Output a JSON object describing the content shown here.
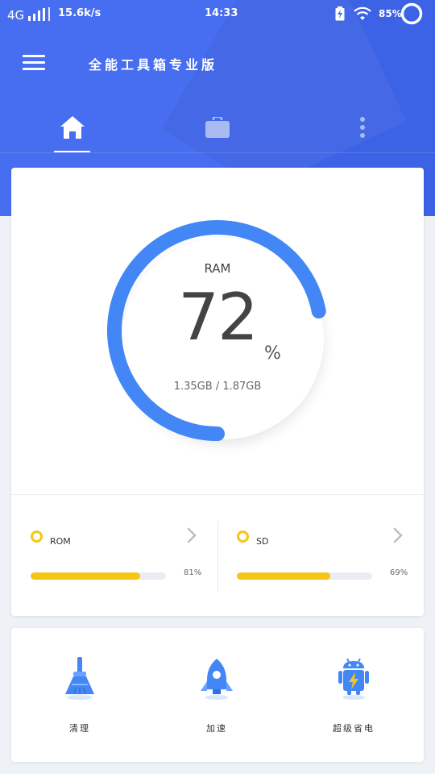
{
  "status_bar": {
    "network": "4G",
    "speed": "15.6k/s",
    "time": "14:33",
    "battery_percent": "85%"
  },
  "app_bar": {
    "title": "全能工具箱专业版"
  },
  "tabs": [
    {
      "name": "home",
      "icon": "home-icon",
      "selected": true
    },
    {
      "name": "toolbox",
      "icon": "briefcase-icon",
      "selected": false
    },
    {
      "name": "more",
      "icon": "more-vertical-icon",
      "selected": false
    }
  ],
  "ram": {
    "label": "RAM",
    "percent": "72",
    "unit": "%",
    "detail": "1.35GB / 1.87GB",
    "progress": 0.72
  },
  "storage": [
    {
      "label": "ROM",
      "percent_text": "81%",
      "progress": 0.81
    },
    {
      "label": "SD",
      "percent_text": "69%",
      "progress": 0.69
    }
  ],
  "tools": [
    {
      "label": "清理",
      "icon": "broom-icon"
    },
    {
      "label": "加速",
      "icon": "rocket-icon"
    },
    {
      "label": "超级省电",
      "icon": "android-battery-icon"
    }
  ],
  "colors": {
    "primary": "#3f67f0",
    "accent_blue": "#4287f5",
    "storage_yellow": "#f5c518"
  }
}
